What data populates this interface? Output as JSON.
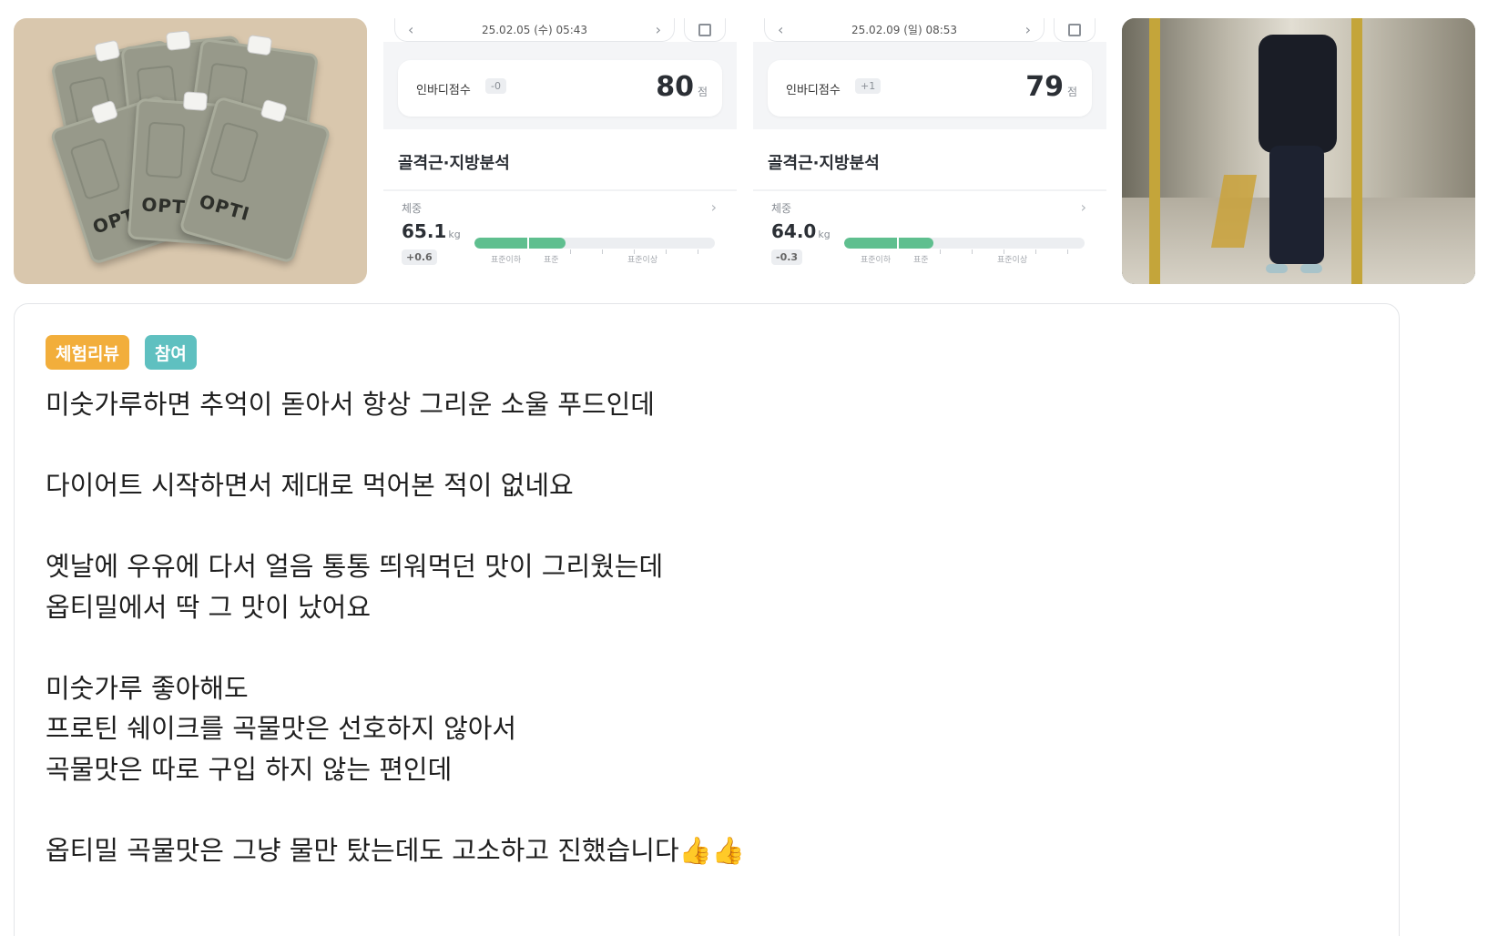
{
  "gallery": {
    "tile1": {
      "brand_text": "OPTI",
      "alt": "product-photo"
    },
    "tile2": {
      "date": "25.02.05 (수) 05:43",
      "score_label": "인바디점수",
      "score_delta": "-0",
      "score": "80",
      "score_unit": "점",
      "section_title": "골격근·지방분석",
      "weight_label": "체중",
      "weight": "65.1",
      "weight_unit": "kg",
      "weight_delta": "+0.6",
      "weight_level": 0.38,
      "range_low": "표준이하",
      "range_mid": "표준",
      "range_high": "표준이상"
    },
    "tile3": {
      "date": "25.02.09 (일) 08:53",
      "score_label": "인바디점수",
      "score_delta": "+1",
      "score": "79",
      "score_unit": "점",
      "section_title": "골격근·지방분석",
      "weight_label": "체중",
      "weight": "64.0",
      "weight_unit": "kg",
      "weight_delta": "-0.3",
      "weight_level": 0.37,
      "range_low": "표준이하",
      "range_mid": "표준",
      "range_high": "표준이상"
    }
  },
  "review": {
    "badge_review": "체험리뷰",
    "badge_join": "참여",
    "lines": [
      "미숫가루하면 추억이 돋아서 항상 그리운 소울 푸드인데",
      "",
      "다이어트 시작하면서 제대로 먹어본 적이 없네요",
      "",
      "옛날에 우유에 다서 얼음 통통 띄워먹던 맛이 그리웠는데",
      "옵티밀에서 딱 그 맛이 났어요",
      "",
      "미숫가루 좋아해도",
      "프로틴 쉐이크를 곡물맛은 선호하지 않아서",
      "곡물맛은 따로 구입 하지 않는 편인데",
      "",
      "옵티밀 곡물맛은 그냥 물만 탔는데도 고소하고 진했습니다👍👍"
    ]
  },
  "colors": {
    "badge_review": "#f2ae3b",
    "badge_join": "#5fc0c0",
    "bar_fill": "#5fbf8f"
  }
}
